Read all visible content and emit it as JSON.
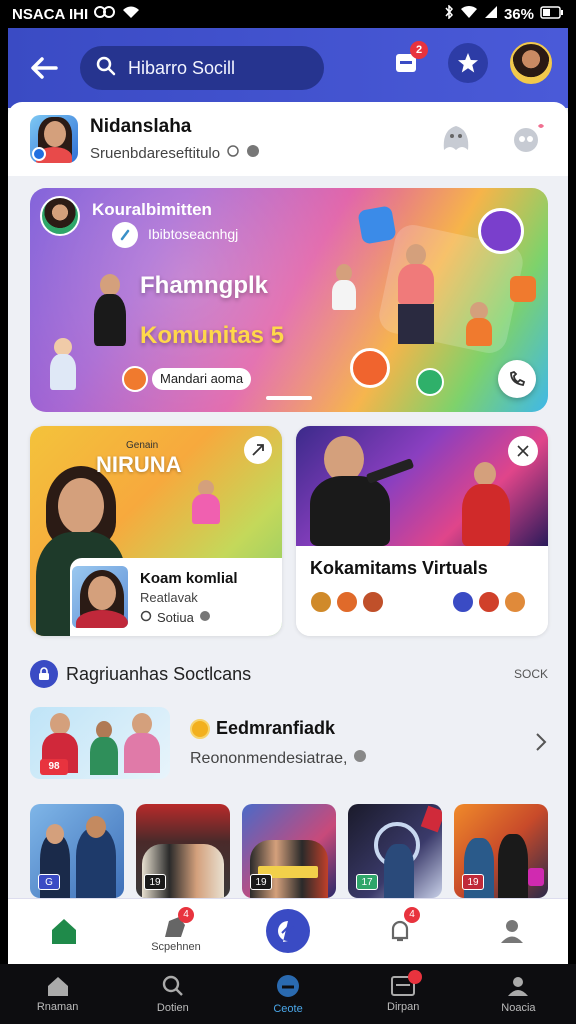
{
  "status_bar": {
    "carrier": "NSACA IHI",
    "battery": "36%"
  },
  "header": {
    "search_text": "Hibarro Socill",
    "notif_count": "2"
  },
  "profile": {
    "name": "Nidanslaha",
    "subtitle": "Sruenbdareseftitulo"
  },
  "hero": {
    "title": "Kouralbimitten",
    "subtitle": "Ibibtoseacnhgj",
    "headline": "Fhamngplk",
    "community": "Komunitas 5",
    "pill": "Mandari aoma"
  },
  "card_left": {
    "top_small": "Genain",
    "big": "NIRUNA",
    "name": "Koam komlial",
    "sub": "Reatlavak",
    "meta": "Sotiua"
  },
  "card_right": {
    "title": "Kokamitams Virtuals"
  },
  "section": {
    "title": "Ragriuanhas Soctlcans",
    "more": "SOCK"
  },
  "group": {
    "title": "Eedmranfiadk",
    "subtitle": "Reononmendesiatrae,",
    "badge": "98"
  },
  "thumbs": [
    {
      "badge": "G"
    },
    {
      "badge": "19"
    },
    {
      "badge": "19"
    },
    {
      "badge": "17"
    },
    {
      "badge": "19"
    }
  ],
  "tabbar": [
    {
      "label": ""
    },
    {
      "label": "Scpehnen",
      "badge": "4"
    },
    {
      "label": ""
    },
    {
      "label": "",
      "badge": "4"
    },
    {
      "label": ""
    }
  ],
  "sysnav": [
    {
      "label": "Rnaman"
    },
    {
      "label": "Dotien"
    },
    {
      "label": "Ceote"
    },
    {
      "label": "Dirpan"
    },
    {
      "label": "Noacia"
    }
  ],
  "colors": {
    "brand": "#3a4bc4",
    "badge": "#e8333e",
    "accent_yellow": "#ffd84a"
  }
}
